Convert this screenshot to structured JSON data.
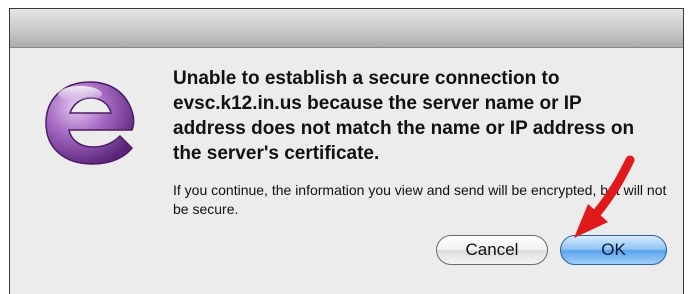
{
  "dialog": {
    "message": "Unable to establish a secure connection to evsc.k12.in.us because the server name or IP address does not match the name or IP address on the server's certificate.",
    "info": "If you continue, the information you view and send will be encrypted, but will not be secure.",
    "icon": "entourage-e-icon"
  },
  "buttons": {
    "cancel_label": "Cancel",
    "ok_label": "OK"
  },
  "annotation": {
    "arrow_color": "#e0191a",
    "arrow_icon": "red-arrow-pointer"
  },
  "colors": {
    "icon_purple": "#7d3f9a",
    "ok_button_blue": "#5aa2ea"
  }
}
